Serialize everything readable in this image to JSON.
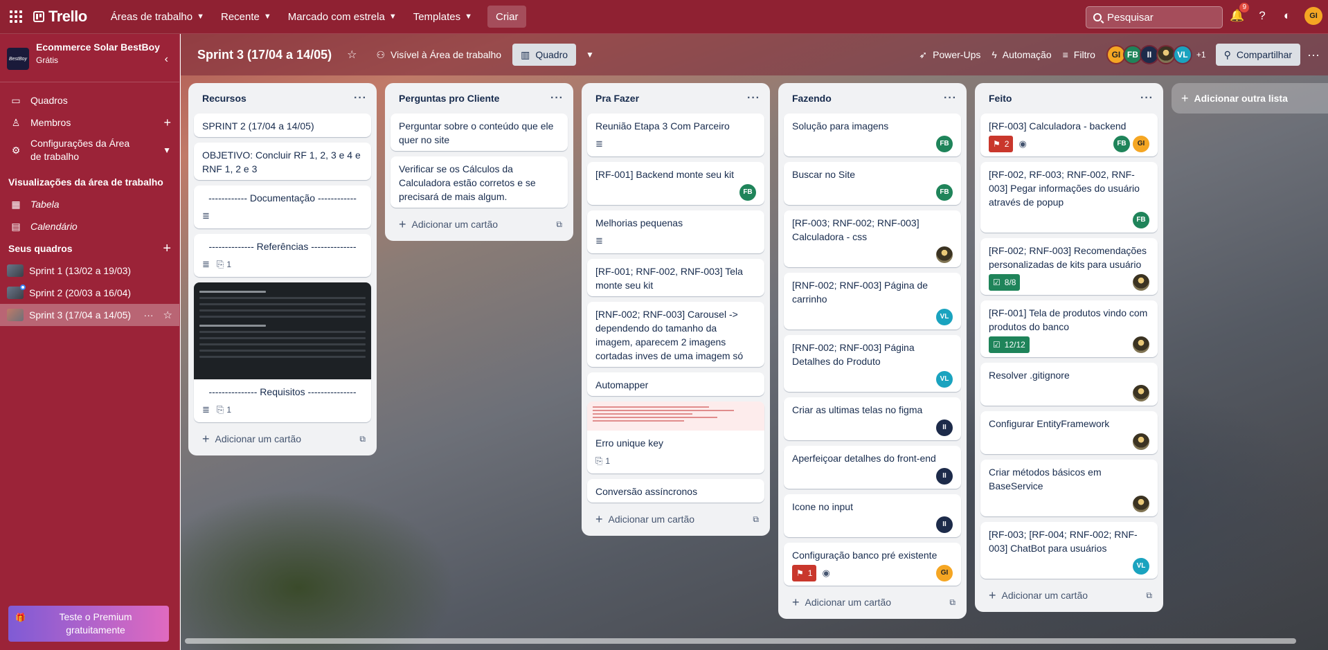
{
  "topnav": {
    "logo": "Trello",
    "menus": [
      "Áreas de trabalho",
      "Recente",
      "Marcado com estrela",
      "Templates"
    ],
    "create": "Criar",
    "search_placeholder": "Pesquisar",
    "notifications_count": "9",
    "user_initials": "GI"
  },
  "sidebar": {
    "workspace_name": "Ecommerce Solar BestBoy",
    "workspace_logo_text": "BestBoy",
    "plan": "Grátis",
    "items": [
      {
        "label": "Quadros",
        "icon": "board-icon"
      },
      {
        "label": "Membros",
        "icon": "person-icon"
      },
      {
        "label": "Configurações da Área de trabalho",
        "icon": "gear-icon"
      }
    ],
    "views_title": "Visualizações da área de trabalho",
    "views": [
      {
        "label": "Tabela",
        "icon": "table-icon"
      },
      {
        "label": "Calendário",
        "icon": "calendar-icon"
      }
    ],
    "boards_title": "Seus quadros",
    "boards": [
      {
        "label": "Sprint 1 (13/02 a 19/03)"
      },
      {
        "label": "Sprint 2 (20/03 a 16/04)"
      },
      {
        "label": "Sprint 3 (17/04 a 14/05)"
      }
    ],
    "premium": "Teste o Premium gratuitamente"
  },
  "board": {
    "title": "Sprint 3 (17/04 a 14/05)",
    "visibility": "Visível à Área de trabalho",
    "view": "Quadro",
    "powerups": "Power-Ups",
    "automation": "Automação",
    "filter": "Filtro",
    "members": [
      "GI",
      "FB",
      "II",
      "",
      "VL"
    ],
    "extra_members": "+1",
    "share": "Compartilhar",
    "add_list": "Adicionar outra lista",
    "add_card": "Adicionar um cartão"
  },
  "lists": [
    {
      "title": "Recursos",
      "cards": [
        {
          "title": "SPRINT 2 (17/04 a 14/05)"
        },
        {
          "title": "OBJETIVO: Concluir RF 1, 2, 3 e 4 e RNF 1, 2 e 3"
        },
        {
          "title": "------------ Documentação ------------"
        },
        {
          "title": "-------------- Referências --------------",
          "attachments": "1"
        },
        {
          "title": "--------------- Requisitos ---------------",
          "attachments": "1"
        }
      ]
    },
    {
      "title": "Perguntas pro Cliente",
      "cards": [
        {
          "title": "Perguntar sobre o conteúdo que ele quer no site"
        },
        {
          "title": "Verificar se os Cálculos da Calculadora estão corretos e se precisará de mais algum."
        }
      ]
    },
    {
      "title": "Pra Fazer",
      "cards": [
        {
          "title": "Reunião Etapa 3 Com Parceiro"
        },
        {
          "title": "[RF-001] Backend monte seu kit",
          "member": "FB"
        },
        {
          "title": "Melhorias pequenas"
        },
        {
          "title": "[RF-001; RNF-002, RNF-003] Tela monte seu kit"
        },
        {
          "title": "[RNF-002; RNF-003] Carousel -> dependendo do tamanho da imagem, aparecem 2 imagens cortadas inves de uma imagem só"
        },
        {
          "title": "Automapper"
        },
        {
          "title": "Erro unique key",
          "attachments": "1"
        },
        {
          "title": "Conversão assíncronos"
        }
      ]
    },
    {
      "title": "Fazendo",
      "cards": [
        {
          "title": "Solução para imagens",
          "member": "FB"
        },
        {
          "title": "Buscar no Site",
          "member": "FB"
        },
        {
          "title": "[RF-003; RNF-002; RNF-003] Calculadora - css"
        },
        {
          "title": "[RNF-002; RNF-003] Página de carrinho",
          "member": "VL"
        },
        {
          "title": "[RNF-002; RNF-003] Página Detalhes do Produto",
          "member": "VL"
        },
        {
          "title": "Criar as ultimas telas no figma",
          "member": "II"
        },
        {
          "title": "Aperfeiçoar detalhes do front-end",
          "member": "II"
        },
        {
          "title": "Icone no input",
          "member": "II"
        },
        {
          "title": "Configuração banco pré existente",
          "votes": "1",
          "member": "GI"
        }
      ]
    },
    {
      "title": "Feito",
      "cards": [
        {
          "title": "[RF-003] Calculadora - backend",
          "votes": "2",
          "members": [
            "FB",
            "GI"
          ]
        },
        {
          "title": "[RF-002, RF-003; RNF-002, RNF-003] Pegar informações do usuário através de popup",
          "member": "FB"
        },
        {
          "title": "[RF-002; RNF-003] Recomendações personalizadas de kits para usuário",
          "checklist": "8/8"
        },
        {
          "title": "[RF-001] Tela de produtos vindo com produtos do banco",
          "checklist": "12/12"
        },
        {
          "title": "Resolver .gitignore"
        },
        {
          "title": "Configurar EntityFramework"
        },
        {
          "title": "Criar métodos básicos em BaseService"
        },
        {
          "title": "[RF-003; [RF-004; RNF-002; RNF-003] ChatBot para usuários",
          "member": "VL"
        }
      ]
    }
  ],
  "colors": {
    "nav": "#8f2132",
    "sidebar": "#9b2338",
    "list_bg": "#f1f2f4",
    "green_badge": "#1f845a",
    "red_badge": "#c9372c"
  }
}
